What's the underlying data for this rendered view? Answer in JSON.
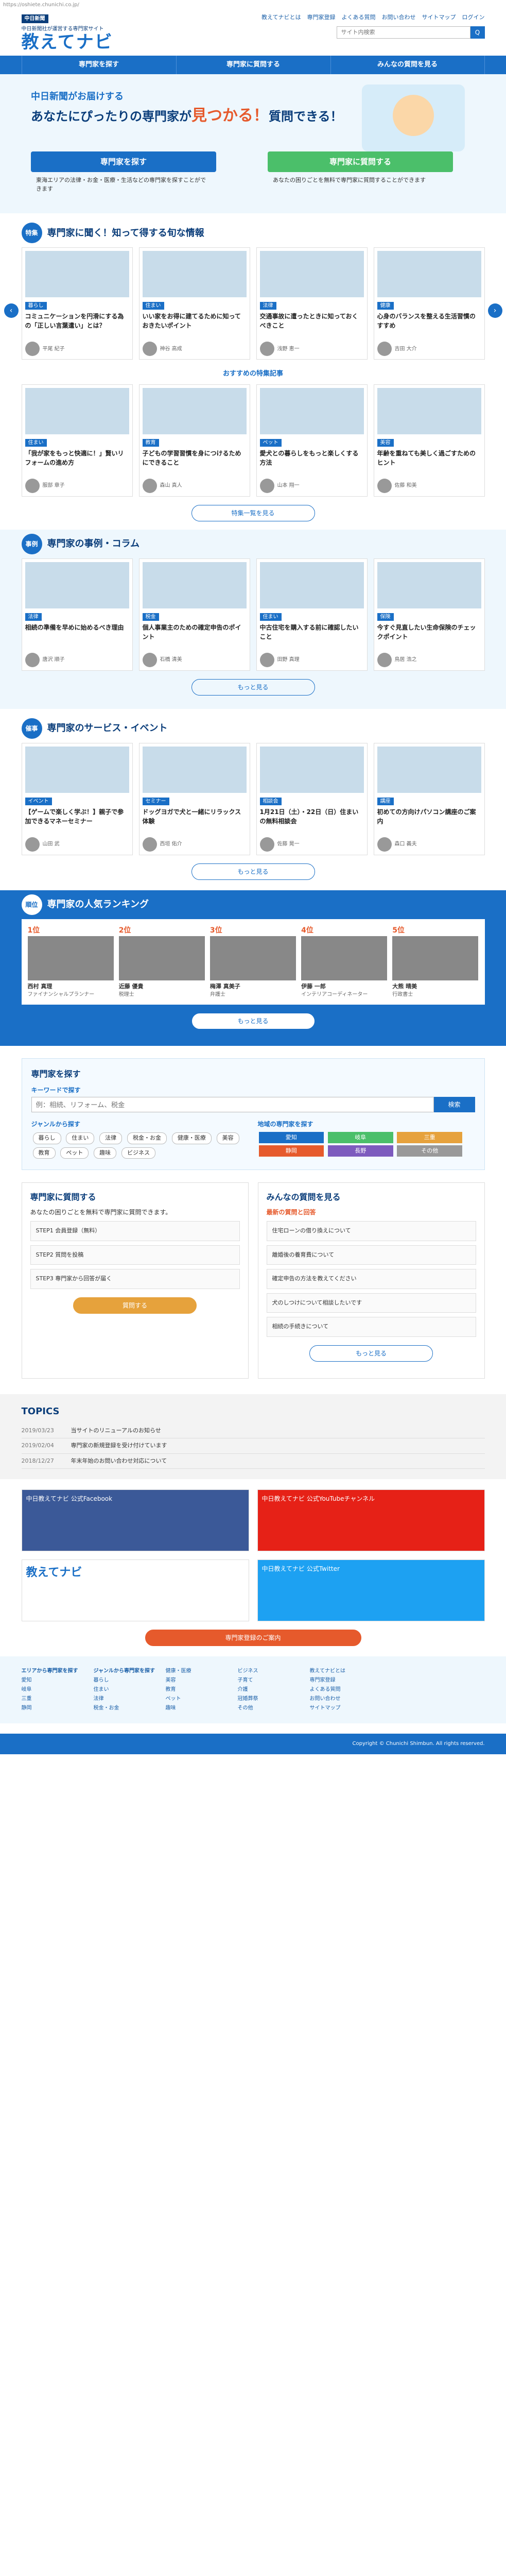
{
  "url": "https://oshiete.chunichi.co.jp/",
  "header": {
    "publisher": "中日新聞",
    "tagline": "中日新聞社が運営する専門家サイト",
    "site_name": "教えてナビ",
    "links": [
      "教えてナビとは",
      "専門家登録",
      "よくある質問",
      "お問い合わせ",
      "サイトマップ",
      "ログイン"
    ],
    "search_placeholder": "サイト内検索",
    "search_btn": "Q"
  },
  "nav": [
    "専門家を探す",
    "専門家に質問する",
    "みんなの質問を見る"
  ],
  "hero": {
    "line1": "中日新聞がお届けする",
    "line2_a": "あなたにぴったりの専門家が",
    "line2_b": "見つかる！",
    "line2_c": "質問できる！",
    "cta": [
      {
        "label": "専門家を探す",
        "color": "#1a6fc6",
        "desc": "東海エリアの法律・お金・医療・生活などの専門家を探すことができます"
      },
      {
        "label": "専門家に質問する",
        "color": "#4bbf6a",
        "desc": "あなたの困りごとを無料で専門家に質問することができます"
      }
    ]
  },
  "sec1": {
    "badge": "特集",
    "title": "専門家に聞く！知って得する旬な情報",
    "cards": [
      {
        "cat": "暮らし",
        "txt": "コミュニケーションを円滑にする為の「正しい言葉遣い」とは？",
        "name": "平尾 紀子"
      },
      {
        "cat": "住まい",
        "txt": "いい家をお得に建てるために知っておきたいポイント",
        "name": "神谷 高成"
      },
      {
        "cat": "法律",
        "txt": "交通事故に遭ったときに知っておくべきこと",
        "name": "浅野 恵一"
      },
      {
        "cat": "健康",
        "txt": "心身のバランスを整える生活習慣のすすめ",
        "name": "吉田 大介"
      }
    ]
  },
  "sub1": {
    "title": "おすすめの特集記事",
    "cards": [
      {
        "cat": "住まい",
        "txt": "「我が家をもっと快適に！」賢いリフォームの進め方",
        "name": "服部 章子"
      },
      {
        "cat": "教育",
        "txt": "子どもの学習習慣を身につけるためにできること",
        "name": "森山 真人"
      },
      {
        "cat": "ペット",
        "txt": "愛犬との暮らしをもっと楽しくする方法",
        "name": "山本 翔一"
      },
      {
        "cat": "美容",
        "txt": "年齢を重ねても美しく過ごすためのヒント",
        "name": "佐藤 和美"
      }
    ],
    "more": "特集一覧を見る"
  },
  "sec2": {
    "badge": "事例",
    "title": "専門家の事例・コラム",
    "cards": [
      {
        "cat": "法律",
        "txt": "相続の準備を早めに始めるべき理由",
        "name": "唐沢 順子"
      },
      {
        "cat": "税金",
        "txt": "個人事業主のための確定申告のポイント",
        "name": "石橋 清美"
      },
      {
        "cat": "住まい",
        "txt": "中古住宅を購入する前に確認したいこと",
        "name": "田野 真理"
      },
      {
        "cat": "保険",
        "txt": "今すぐ見直したい生命保険のチェックポイント",
        "name": "鳥居 浩之"
      }
    ],
    "more": "もっと見る"
  },
  "sec3": {
    "badge": "催事",
    "title": "専門家のサービス・イベント",
    "cards": [
      {
        "cat": "イベント",
        "txt": "【ゲームで楽しく学ぶ！】親子で参加できるマネーセミナー",
        "name": "山田 武"
      },
      {
        "cat": "セミナー",
        "txt": "ドッグヨガで犬と一緒にリラックス体験",
        "name": "西垣 佑介"
      },
      {
        "cat": "相談会",
        "txt": "1月21日（土）・22日（日）住まいの無料相談会",
        "name": "佐藤 晃一"
      },
      {
        "cat": "講座",
        "txt": "初めての方向けパソコン講座のご案内",
        "name": "森口 義夫"
      }
    ],
    "more": "もっと見る"
  },
  "ranking": {
    "badge": "順位",
    "title": "専門家の人気ランキング",
    "top5": [
      {
        "rank": "1位",
        "name": "西村 真理",
        "sub": "ファイナンシャルプランナー"
      },
      {
        "rank": "2位",
        "name": "近藤 優貴",
        "sub": "税理士"
      },
      {
        "rank": "3位",
        "name": "梅澤 真美子",
        "sub": "弁護士"
      },
      {
        "rank": "4位",
        "name": "伊藤 一郎",
        "sub": "インテリアコーディネーター"
      },
      {
        "rank": "5位",
        "name": "大熊 晴美",
        "sub": "行政書士"
      }
    ],
    "more": "もっと見る"
  },
  "search": {
    "title": "専門家を探す",
    "kw_label": "キーワードで探す",
    "kw_placeholder": "例：相続、リフォーム、税金",
    "kw_btn": "検索",
    "genre_label": "ジャンルから探す",
    "genres": [
      "暮らし",
      "住まい",
      "法律",
      "税金・お金",
      "健康・医療",
      "美容",
      "教育",
      "ペット",
      "趣味",
      "ビジネス"
    ],
    "area_label": "地域の専門家を探す",
    "areas": [
      {
        "n": "愛知",
        "c": "#1a6fc6"
      },
      {
        "n": "岐阜",
        "c": "#4bbf6a"
      },
      {
        "n": "三重",
        "c": "#e6a23c"
      },
      {
        "n": "静岡",
        "c": "#e65a2c"
      },
      {
        "n": "長野",
        "c": "#7d5bbe"
      },
      {
        "n": "その他",
        "c": "#999999"
      }
    ]
  },
  "ask": {
    "title": "専門家に質問する",
    "lead": "あなたの困りごとを無料で専門家に質問できます。",
    "steps": [
      "STEP1 会員登録（無料）",
      "STEP2 質問を投稿",
      "STEP3 専門家から回答が届く"
    ],
    "btn": "質問する"
  },
  "qa": {
    "title": "みんなの質問を見る",
    "lead": "最新の質問と回答",
    "items": [
      "住宅ローンの借り換えについて",
      "離婚後の養育費について",
      "確定申告の方法を教えてください",
      "犬のしつけについて相談したいです",
      "相続の手続きについて"
    ],
    "btn": "もっと見る"
  },
  "topics": {
    "title": "TOPICS",
    "rows": [
      {
        "d": "2019/03/23",
        "t": "当サイトのリニューアルのお知らせ"
      },
      {
        "d": "2019/02/04",
        "t": "専門家の新規登録を受け付けています"
      },
      {
        "d": "2018/12/27",
        "t": "年末年始のお問い合わせ対応について"
      }
    ]
  },
  "sns": [
    "中日教えてナビ 公式Facebook",
    "中日教えてナビ 公式YouTubeチャンネル",
    "中日教えてナビ 公式Twitter",
    "専門家登録のご案内"
  ],
  "footer": {
    "cols": [
      [
        "エリアから専門家を探す",
        "愛知",
        "岐阜",
        "三重",
        "静岡"
      ],
      [
        "ジャンルから専門家を探す",
        "暮らし",
        "住まい",
        "法律",
        "税金・お金"
      ],
      [
        "健康・医療",
        "美容",
        "教育",
        "ペット",
        "趣味"
      ],
      [
        "ビジネス",
        "子育て",
        "介護",
        "冠婚葬祭",
        "その他"
      ],
      [
        "教えてナビとは",
        "専門家登録",
        "よくある質問",
        "お問い合わせ",
        "サイトマップ"
      ]
    ],
    "copy": "Copyright © Chunichi Shimbun. All rights reserved."
  }
}
